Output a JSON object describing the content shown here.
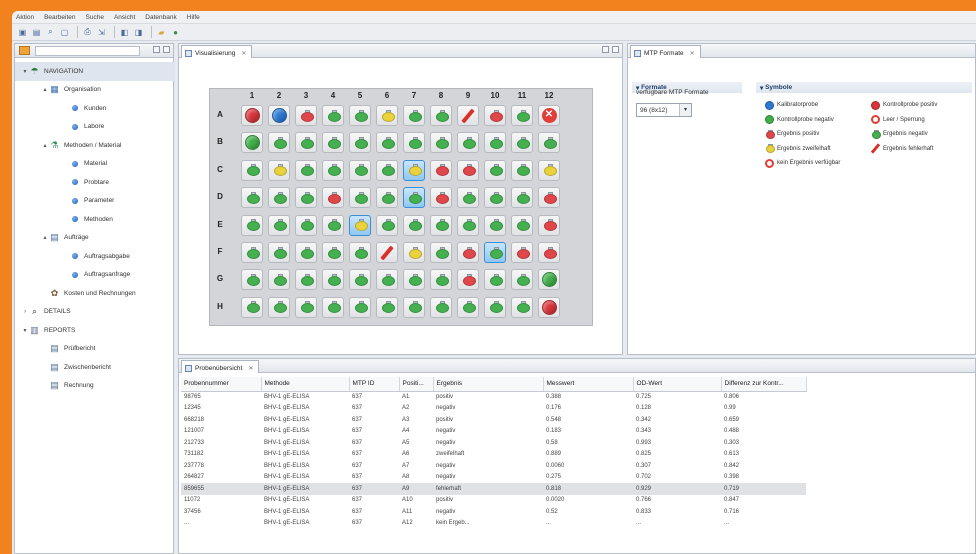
{
  "menu": [
    "Aktion",
    "Bearbeiten",
    "Suche",
    "Ansicht",
    "Datenbank",
    "Hilfe"
  ],
  "nav": {
    "items": [
      {
        "label": "NAVIGATION",
        "level": 0,
        "arrow": "▾",
        "icon": "umbrella-icon",
        "selected": true
      },
      {
        "label": "Organisation",
        "level": 1,
        "arrow": "▴",
        "icon": "organization-icon"
      },
      {
        "label": "Kunden",
        "level": 2,
        "icon": "bullet-icon"
      },
      {
        "label": "Labore",
        "level": 2,
        "icon": "bullet-icon"
      },
      {
        "label": "Methoden / Material",
        "level": 1,
        "arrow": "▴",
        "icon": "flask-icon"
      },
      {
        "label": "Material",
        "level": 2,
        "icon": "bullet-icon"
      },
      {
        "label": "Probtare",
        "level": 2,
        "icon": "bullet-icon"
      },
      {
        "label": "Parameter",
        "level": 2,
        "icon": "bullet-icon"
      },
      {
        "label": "Methoden",
        "level": 2,
        "icon": "bullet-icon"
      },
      {
        "label": "Aufträge",
        "level": 1,
        "arrow": "▴",
        "icon": "orders-icon"
      },
      {
        "label": "Auftragsabgabe",
        "level": 2,
        "icon": "bullet-icon"
      },
      {
        "label": "Auftragsanfrage",
        "level": 2,
        "icon": "bullet-icon"
      },
      {
        "label": "Kosten und Rechnungen",
        "level": 1,
        "icon": "costs-icon"
      },
      {
        "label": "DETAILS",
        "level": 0,
        "arrow": "›",
        "icon": "magnifier-icon"
      },
      {
        "label": "REPORTS",
        "level": 0,
        "arrow": "▾",
        "icon": "reports-icon"
      },
      {
        "label": "Prüfbericht",
        "level": 1,
        "icon": "document-icon"
      },
      {
        "label": "Zwischenbericht",
        "level": 1,
        "icon": "document-icon"
      },
      {
        "label": "Rechnung",
        "level": 1,
        "icon": "document-icon"
      }
    ]
  },
  "vis": {
    "tab": "Visualisierung"
  },
  "plate": {
    "columns": [
      "1",
      "2",
      "3",
      "4",
      "5",
      "6",
      "7",
      "8",
      "9",
      "10",
      "11",
      "12"
    ],
    "rows": [
      "A",
      "B",
      "C",
      "D",
      "E",
      "F",
      "G",
      "H"
    ],
    "wells": [
      [
        "calr",
        "calb",
        "red",
        "g",
        "g",
        "y",
        "g",
        "g",
        "pen",
        "red",
        "g",
        "nores"
      ],
      [
        "kneg",
        "g",
        "g",
        "g",
        "g",
        "g",
        "g",
        "g",
        "g",
        "g",
        "g",
        "g"
      ],
      [
        "g",
        "y",
        "g",
        "g",
        "g",
        "g",
        "y*",
        "red",
        "red",
        "g",
        "g",
        "y"
      ],
      [
        "g",
        "g",
        "g",
        "red",
        "g",
        "g",
        "g*",
        "red",
        "g",
        "g",
        "g",
        "red"
      ],
      [
        "g",
        "g",
        "g",
        "g",
        "y*",
        "g",
        "g",
        "g",
        "g",
        "g",
        "g",
        "red"
      ],
      [
        "g",
        "g",
        "g",
        "g",
        "g",
        "pen",
        "y",
        "g",
        "red",
        "g*",
        "red",
        "red"
      ],
      [
        "g",
        "g",
        "g",
        "g",
        "g",
        "g",
        "g",
        "g",
        "red",
        "g",
        "g",
        "kneg"
      ],
      [
        "g",
        "g",
        "g",
        "g",
        "g",
        "g",
        "g",
        "g",
        "g",
        "g",
        "g",
        "calr"
      ]
    ]
  },
  "mtp": {
    "tab": "MTP Formate",
    "formate_header": "Formate",
    "symbole_header": "Symbole",
    "available_label": "verfügbare MTP Formate",
    "selected_format": "96 (8x12)",
    "legend": [
      {
        "label": "Kalibratorprobe",
        "kind": "ball",
        "color": "#2a79d2"
      },
      {
        "label": "Kontrollprobe positiv",
        "kind": "ball",
        "color": "#d8353a"
      },
      {
        "label": "Kontrollprobe negativ",
        "kind": "ball",
        "color": "#3fae49"
      },
      {
        "label": "Leer / Sperrung",
        "kind": "nores"
      },
      {
        "label": "Ergebnis positiv",
        "kind": "flask",
        "color": "#e0474a"
      },
      {
        "label": "Ergebnis negativ",
        "kind": "flask",
        "color": "#45b050"
      },
      {
        "label": "Ergebnis zweifelhaft",
        "kind": "flask",
        "color": "#e9d23c"
      },
      {
        "label": "Ergebnis fehlerhaft",
        "kind": "pen"
      },
      {
        "label": "kein Ergebnis verfügbar",
        "kind": "nores"
      }
    ]
  },
  "table": {
    "tab": "Probenübersicht",
    "columns": [
      "Probennummer",
      "Methode",
      "MTP ID",
      "Positi...",
      "Ergebnis",
      "Messwert",
      "OD-Wert",
      "Differenz zur Kontr..."
    ],
    "rows": [
      [
        "98765",
        "BHV-1 gE-ELISA",
        "637",
        "A1",
        "positiv",
        "0.388",
        "0.725",
        "0.806"
      ],
      [
        "12345",
        "BHV-1 gE-ELISA",
        "637",
        "A2",
        "negativ",
        "0.176",
        "0.128",
        "0.99"
      ],
      [
        "668218",
        "BHV-1 gE-ELISA",
        "637",
        "A3",
        "positiv",
        "0.548",
        "0.342",
        "0.659"
      ],
      [
        "121007",
        "BHV-1 gE-ELISA",
        "637",
        "A4",
        "negativ",
        "0.183",
        "0.343",
        "0.488"
      ],
      [
        "212733",
        "BHV-1 gE-ELISA",
        "637",
        "A5",
        "negativ",
        "0.58",
        "0.993",
        "0.303"
      ],
      [
        "731182",
        "BHV-1 gE-ELISA",
        "637",
        "A6",
        "zweifelhaft",
        "0.889",
        "0.825",
        "0.613"
      ],
      [
        "237778",
        "BHV-1 gE-ELISA",
        "637",
        "A7",
        "negativ",
        "0.0060",
        "0.307",
        "0.842"
      ],
      [
        "264827",
        "BHV-1 gE-ELISA",
        "637",
        "A8",
        "negativ",
        "0.275",
        "0.702",
        "0.398"
      ],
      [
        "859655",
        "BHV-1 gE-ELISA",
        "637",
        "A9",
        "fehlerhaft",
        "0.818",
        "0.929",
        "0.719"
      ],
      [
        "11072",
        "BHV-1 gE-ELISA",
        "637",
        "A10",
        "positiv",
        "0.0020",
        "0.766",
        "0.847"
      ],
      [
        "37456",
        "BHV-1 gE-ELISA",
        "637",
        "A11",
        "negativ",
        "0.52",
        "0.833",
        "0.716"
      ],
      [
        "...",
        "BHV-1 gE-ELISA",
        "637",
        "A12",
        "kein Ergeb...",
        "...",
        "...",
        "..."
      ]
    ],
    "selected_row": 8
  }
}
